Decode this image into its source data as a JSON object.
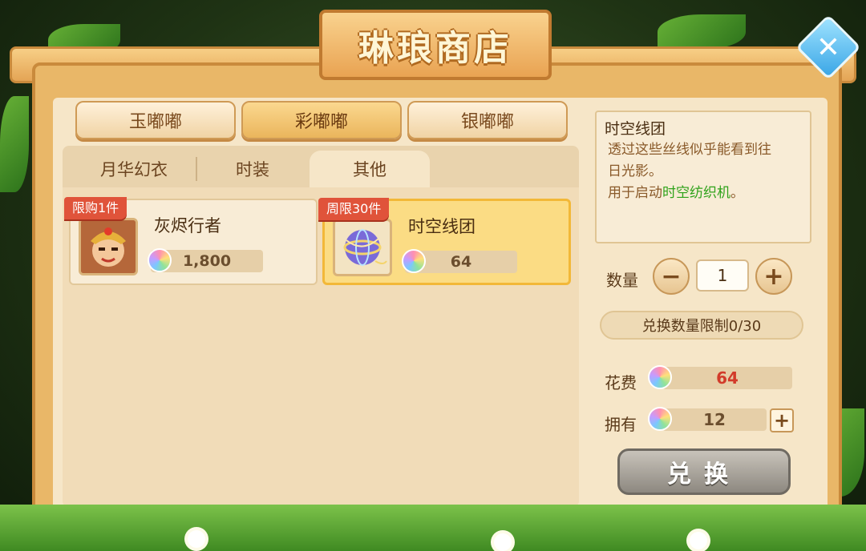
{
  "shop": {
    "title": "琳琅商店"
  },
  "categories": [
    "玉嘟嘟",
    "彩嘟嘟",
    "银嘟嘟"
  ],
  "active_category": "彩嘟嘟",
  "tabs": [
    "月华幻衣",
    "时装",
    "其他"
  ],
  "active_tab": "其他",
  "items": [
    {
      "badge": "限购1件",
      "name": "灰烬行者",
      "price": "1,800",
      "icon": "masked-warrior-portrait"
    },
    {
      "badge": "周限30件",
      "name": "时空线团",
      "price": "64",
      "icon": "yarn-ball-icon"
    }
  ],
  "selected_item": "时空线团",
  "detail": {
    "title": "时空线团",
    "desc_line1": "透过这些丝线似乎能看到往",
    "desc_line2": "日光影。",
    "desc_line3_prefix": "用于启动",
    "desc_line3_highlight": "时空纺织机",
    "desc_line3_suffix": "。"
  },
  "quantity": {
    "label": "数量",
    "value": "1",
    "minus": "−",
    "plus": "+"
  },
  "limit_text": "兑换数量限制0/30",
  "cost": {
    "label": "花费",
    "value": "64",
    "color": "#d23b2a"
  },
  "owned": {
    "label": "拥有",
    "value": "12",
    "plus": "+"
  },
  "exchange_label": "兑换",
  "close_label": "✕",
  "colors": {
    "accent": "#f2b838",
    "highlight_text": "#2fa21a"
  }
}
